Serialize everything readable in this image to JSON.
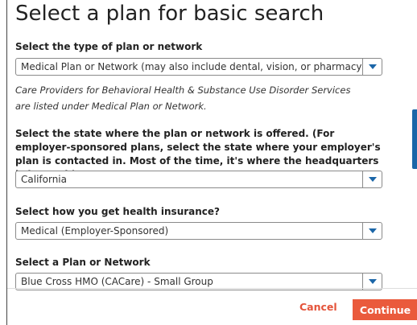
{
  "page": {
    "title": "Select a plan for basic search"
  },
  "fields": {
    "plan_type": {
      "label": "Select the type of plan or network",
      "value": "Medical Plan or Network (may also include dental, vision, or pharmacy benefits)"
    },
    "note_line1": "Care Providers for Behavioral Health & Substance Use Disorder Services",
    "note_line2": "are listed under Medical Plan or Network.",
    "state": {
      "label": "Select the state where the plan or network is offered. (For employer-sponsored plans, select the state where your employer's plan is contacted in. Most of the time, it's where the headquarters is located.)",
      "value": "California"
    },
    "insurance_source": {
      "label": "Select how you get health insurance?",
      "value": "Medical (Employer-Sponsored)"
    },
    "plan": {
      "label": "Select a Plan or Network",
      "value": "Blue Cross HMO (CACare) - Small Group"
    }
  },
  "actions": {
    "cancel": "Cancel",
    "continue": "Continue"
  },
  "colors": {
    "accent": "#1b66a8",
    "primary_button": "#ea5a3c",
    "cancel_text": "#e4533a"
  }
}
